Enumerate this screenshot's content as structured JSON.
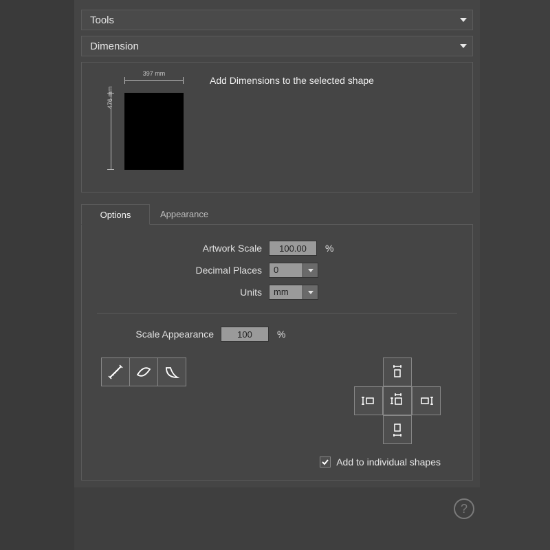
{
  "headers": {
    "tools": "Tools",
    "dimension": "Dimension"
  },
  "hint": {
    "text": "Add Dimensions to the selected shape",
    "width_label": "397 mm",
    "height_label": "476 mm"
  },
  "tabs": {
    "options": "Options",
    "appearance": "Appearance"
  },
  "options": {
    "artwork_scale_label": "Artwork Scale",
    "artwork_scale_value": "100.00",
    "artwork_scale_suffix": "%",
    "decimal_places_label": "Decimal Places",
    "decimal_places_value": "0",
    "units_label": "Units",
    "units_value": "mm",
    "scale_appearance_label": "Scale Appearance",
    "scale_appearance_value": "100",
    "scale_appearance_suffix": "%"
  },
  "checkbox": {
    "add_individual_label": "Add to individual shapes",
    "add_individual_checked": true
  },
  "help": "?"
}
